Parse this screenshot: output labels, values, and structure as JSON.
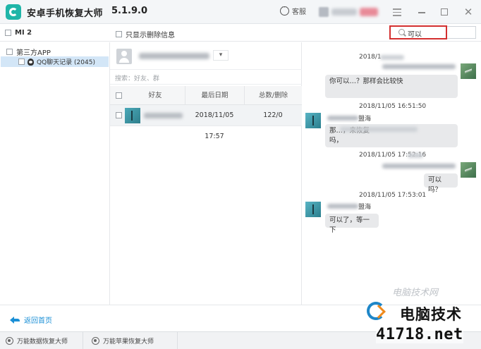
{
  "window": {
    "title": "安卓手机恢复大师",
    "version": "5.1.9.0",
    "support_label": "客服"
  },
  "toolbar": {
    "device_name": "MI 2",
    "only_deleted_label": "只显示删除信息",
    "search_value": "可以"
  },
  "sidebar": {
    "root_label": "第三方APP",
    "items": [
      {
        "label": "QQ聊天记录 (2045)"
      }
    ]
  },
  "contacts": {
    "search_placeholder": "搜索：好友、群",
    "dropdown_glyph": "▾",
    "columns": [
      "好友",
      "最后日期",
      "总数/删除"
    ],
    "rows": [
      {
        "date": "2018/11/05 17:57",
        "count": "122/0"
      }
    ]
  },
  "chat": {
    "messages": [
      {
        "side": "me",
        "timestamp": "2018/1",
        "text": "你可以…？那样会比较快"
      },
      {
        "side": "other",
        "timestamp": "2018/11/05 16:51:50",
        "sender_suffix": "盟海",
        "text_a": "那…，来恢复",
        "text_b": "吗，"
      },
      {
        "side": "me",
        "timestamp": "2018/11/05 17:52:16",
        "text": "可以吗？"
      },
      {
        "side": "other",
        "timestamp": "2018/11/05 17:53:01",
        "sender_suffix": "盟海",
        "text": "可以了，等一下"
      }
    ]
  },
  "bottom": {
    "back_label": "返回首页"
  },
  "footer": {
    "items": [
      {
        "label": "万能数据恢复大师"
      },
      {
        "label": "万能苹果恢复大师"
      }
    ]
  },
  "watermark": {
    "brand": "电脑技术网",
    "title": "电脑技术",
    "site": "41718.net"
  },
  "colors": {
    "accent": "#1a8fd6",
    "logo": "#1fb5a8",
    "highlight": "#d32f2f",
    "selected_row": "#d3e6f7"
  }
}
